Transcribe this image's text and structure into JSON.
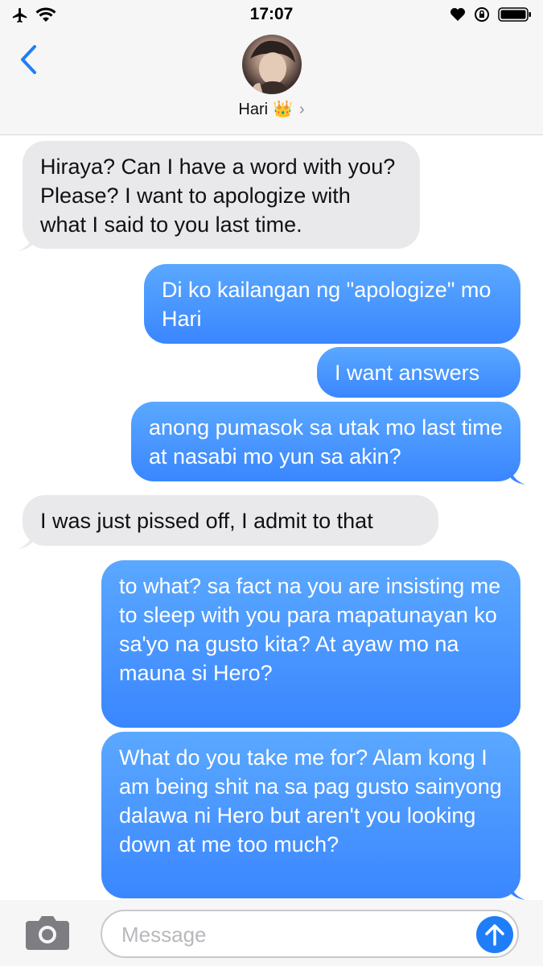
{
  "status_bar": {
    "time": "17:07",
    "icons_left": [
      "airplane-icon",
      "wifi-icon"
    ],
    "icons_right": [
      "heart-icon",
      "rotation-lock-icon",
      "battery-icon"
    ]
  },
  "header": {
    "contact_name": "Hari",
    "contact_emoji": "👑",
    "chevron": "›"
  },
  "messages": [
    {
      "direction": "incoming",
      "text": "Hiraya? Can I have a word with you? Please? I want to apologize with what I said to you last time."
    },
    {
      "direction": "outgoing",
      "text": "Di ko kailangan ng \"apologize\" mo Hari"
    },
    {
      "direction": "outgoing",
      "text": "I want answers"
    },
    {
      "direction": "outgoing",
      "text": "anong pumasok sa utak mo last time at nasabi mo yun sa akin?"
    },
    {
      "direction": "incoming",
      "text": "I was just pissed off, I admit to that"
    },
    {
      "direction": "outgoing",
      "text": "to what? sa fact na you are insisting me to sleep with you para mapatunayan ko sa'yo na gusto kita? At ayaw mo na mauna si Hero?"
    },
    {
      "direction": "outgoing",
      "text": "What do you take me for? Alam kong I am being shit na sa pag gusto sainyong dalawa ni Hero but aren't you looking down at me too much?"
    }
  ],
  "input": {
    "placeholder": "Message"
  },
  "colors": {
    "incoming_bubble": "#e9e9eb",
    "outgoing_bubble": "#3a86ff",
    "send_button": "#1f7ef7",
    "accent": "#1f7ef7"
  }
}
